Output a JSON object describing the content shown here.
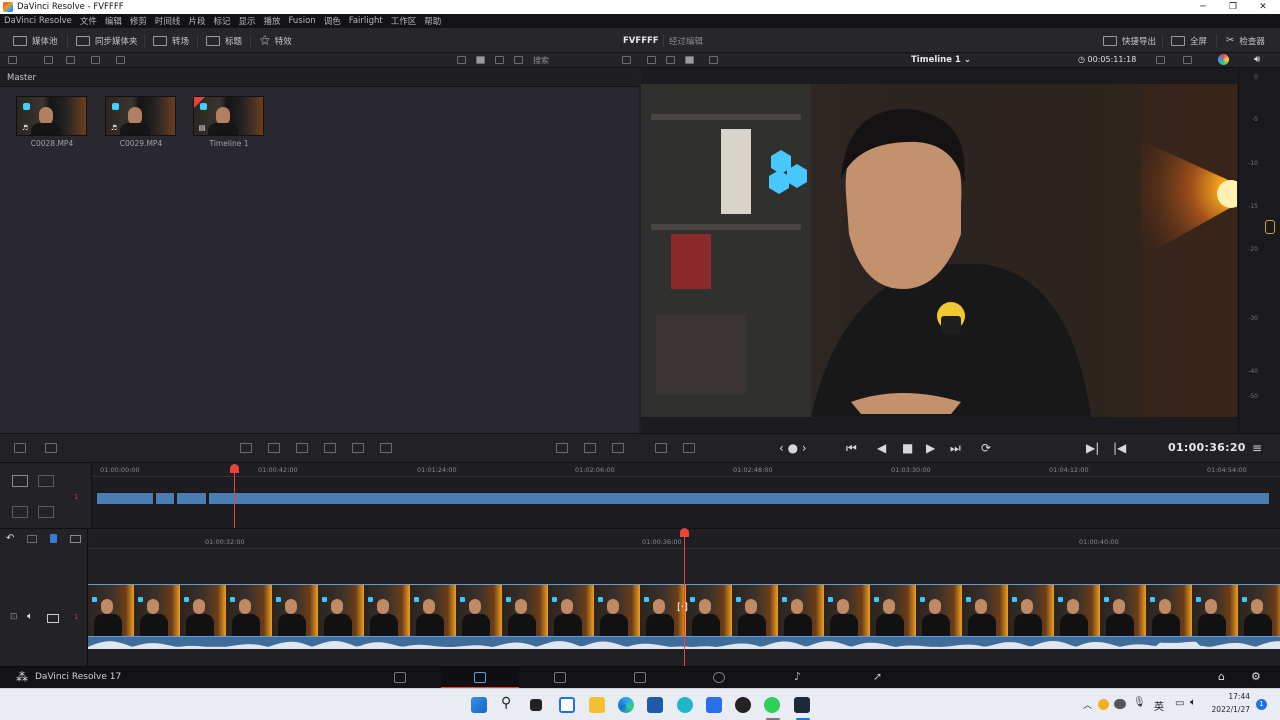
{
  "window": {
    "title": "DaVinci Resolve - FVFFFF",
    "minimize": "─",
    "maximize": "❐",
    "close": "✕"
  },
  "menu": [
    "DaVinci Resolve",
    "文件",
    "编辑",
    "修剪",
    "时间线",
    "片段",
    "标记",
    "显示",
    "播放",
    "Fusion",
    "调色",
    "Fairlight",
    "工作区",
    "帮助"
  ],
  "toolbar": {
    "media_pool": "媒体池",
    "sync_bin": "同步媒体夹",
    "transitions": "转场",
    "titles": "标题",
    "effects": "特效",
    "project_name": "FVFFFF",
    "project_status": "经过编辑",
    "quick_export": "快捷导出",
    "fullscreen": "全屏",
    "inspector": "检查器"
  },
  "media_pool": {
    "search_placeholder": "搜索",
    "bin": "Master",
    "clips": [
      {
        "name": "C0028.MP4",
        "badge": "♬"
      },
      {
        "name": "C0029.MP4",
        "badge": "♬"
      },
      {
        "name": "Timeline 1",
        "badge": "▤"
      }
    ]
  },
  "viewer": {
    "timeline_name": "Timeline 1",
    "duration": "00:05:11:18",
    "timecode": "01:00:36:20"
  },
  "meter": {
    "ticks": [
      "0",
      "-5",
      "-10",
      "-15",
      "-20",
      "-30",
      "-40",
      "-50"
    ]
  },
  "upper_timeline": {
    "labels": [
      "01:00:00:00",
      "01:00:42:00",
      "01:01:24:00",
      "01:02:06:00",
      "01:02:48:00",
      "01:03:30:00",
      "01:04:12:00",
      "01:04:54:00"
    ],
    "track": "1"
  },
  "lower_timeline": {
    "labels": [
      "01:00:32:00",
      "01:00:36:00",
      "01:00:40:00"
    ],
    "track": "1"
  },
  "bottom_nav": {
    "app": "DaVinci Resolve 17"
  },
  "taskbar": {
    "time": "17:44",
    "date": "2022/1/27",
    "ime": "英",
    "notifications": "1"
  },
  "colors": {
    "accent_red": "#e8443a",
    "clip_blue": "#4a7db0",
    "panel": "#28282e"
  }
}
